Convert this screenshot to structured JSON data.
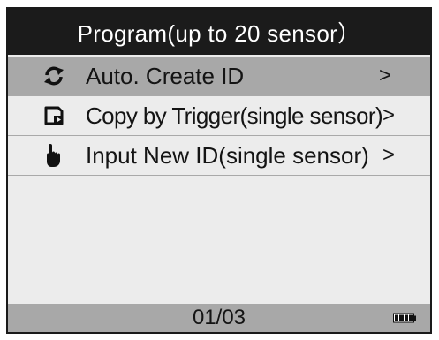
{
  "header": {
    "title": "Program(up  to  20  sensor）"
  },
  "menu": {
    "items": [
      {
        "label": "Auto. Create ID",
        "icon": "refresh-arrows-icon",
        "arrow": ">",
        "selected": true
      },
      {
        "label": "Copy by Trigger(single sensor)",
        "icon": "copy-trigger-icon",
        "arrow": ">",
        "selected": false
      },
      {
        "label": "Input New ID(single sensor)",
        "icon": "pointing-hand-icon",
        "arrow": ">",
        "selected": false
      }
    ]
  },
  "footer": {
    "page_indicator": "01/03",
    "battery_icon": "battery-icon",
    "battery_level": 1.0
  },
  "colors": {
    "titlebar_bg": "#1b1b1b",
    "selected_bg": "#a8a8a8",
    "screen_bg": "#ececec",
    "statusbar_bg": "#a8a8a8"
  }
}
